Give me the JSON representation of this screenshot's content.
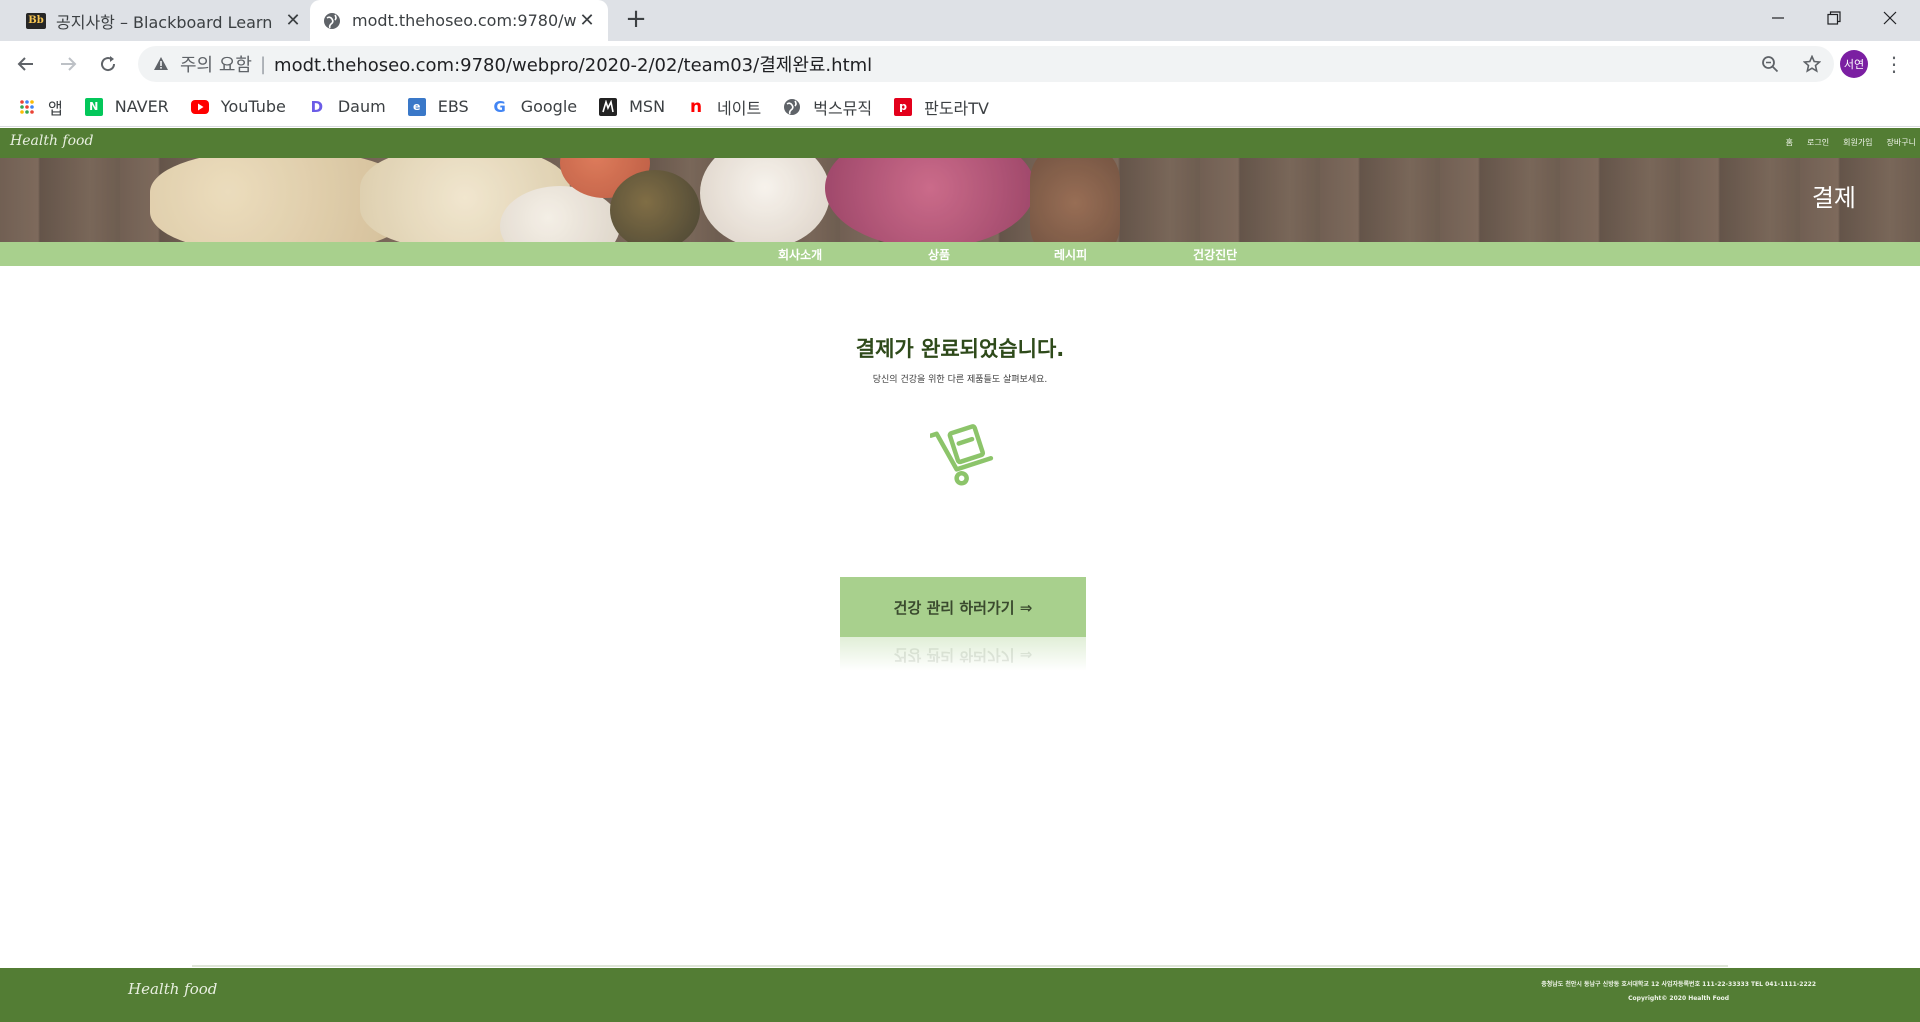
{
  "browser": {
    "tabs": [
      {
        "title": "공지사항 – Blackboard Learn",
        "favicon": "blackboard-icon",
        "favicon_text": "Bb"
      },
      {
        "title": "modt.thehoseo.com:9780/webpro",
        "favicon": "globe-icon"
      }
    ],
    "address": {
      "security_label": "주의 요함",
      "separator": "|",
      "url": "modt.thehoseo.com:9780/webpro/2020-2/02/team03/결제완료.html"
    },
    "profile_initials": "서연",
    "bookmarks": [
      {
        "label": "앱",
        "icon": "apps-grid-icon"
      },
      {
        "label": "NAVER",
        "icon": "naver-icon",
        "icon_text": "N",
        "color": "#03c75a"
      },
      {
        "label": "YouTube",
        "icon": "youtube-icon",
        "color": "#ff0000"
      },
      {
        "label": "Daum",
        "icon": "daum-icon",
        "icon_text": "D"
      },
      {
        "label": "EBS",
        "icon": "ebs-icon",
        "icon_text": "e"
      },
      {
        "label": "Google",
        "icon": "google-icon",
        "icon_text": "G"
      },
      {
        "label": "MSN",
        "icon": "msn-icon"
      },
      {
        "label": "네이트",
        "icon": "nate-icon",
        "icon_text": "n",
        "color": "#ff0000"
      },
      {
        "label": "벅스뮤직",
        "icon": "globe-icon"
      },
      {
        "label": "판도라TV",
        "icon": "pandora-icon",
        "icon_text": "p",
        "color": "#e3001b"
      }
    ]
  },
  "site": {
    "logo": "Health food",
    "top_links": [
      "홈",
      "로그인",
      "회원가입",
      "장바구니"
    ],
    "hero_title": "결제",
    "nav": [
      "회사소개",
      "상품",
      "레시피",
      "건강진단"
    ],
    "confirmation": {
      "title": "결제가 완료되었습니다.",
      "subtitle": "당신의 건강을 위한 다른 제품들도 살펴보세요.",
      "icon": "hand-truck-icon",
      "cta_label": "건강 관리 하러가기 ⇒"
    },
    "footer": {
      "logo": "Health food",
      "address_line": "충청남도 천안시 동남구 신방동 호서대학교 12 사업자등록번호 111-22-33333 TEL 041-1111-2222",
      "copyright": "Copyright© 2020 Health Food"
    },
    "colors": {
      "primary_green": "#537d34",
      "light_green": "#a8d08d",
      "title_green": "#2e4a1a"
    }
  }
}
